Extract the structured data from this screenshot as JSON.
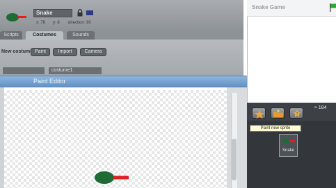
{
  "sprite": {
    "name": "Snake",
    "x_label": "x: 76",
    "y_label": "y: 8",
    "direction_label": "direction: 90"
  },
  "tabs": [
    "Scripts",
    "Costumes",
    "Sounds"
  ],
  "costumes": {
    "new_costume_label": "New costume:",
    "paint_label": "Paint",
    "import_label": "Import",
    "camera_label": "Camera",
    "costume_name": "costume1"
  },
  "paint_editor": {
    "title": "Paint Editor"
  },
  "stage": {
    "title": "Snake Game",
    "size_label": "≈ 184"
  },
  "library": {
    "tooltip": "Paint new sprite",
    "sprite_label": "Snake"
  },
  "colors": {
    "snake_body": "#1e6b35",
    "snake_tongue": "#e02020",
    "editor_title": "#6c9bcf",
    "sprite_chip": "#2b3a8f"
  },
  "icons": [
    "lock-icon",
    "green-flag-icon",
    "paint-new-sprite-icon",
    "choose-sprite-icon",
    "surprise-sprite-icon"
  ]
}
